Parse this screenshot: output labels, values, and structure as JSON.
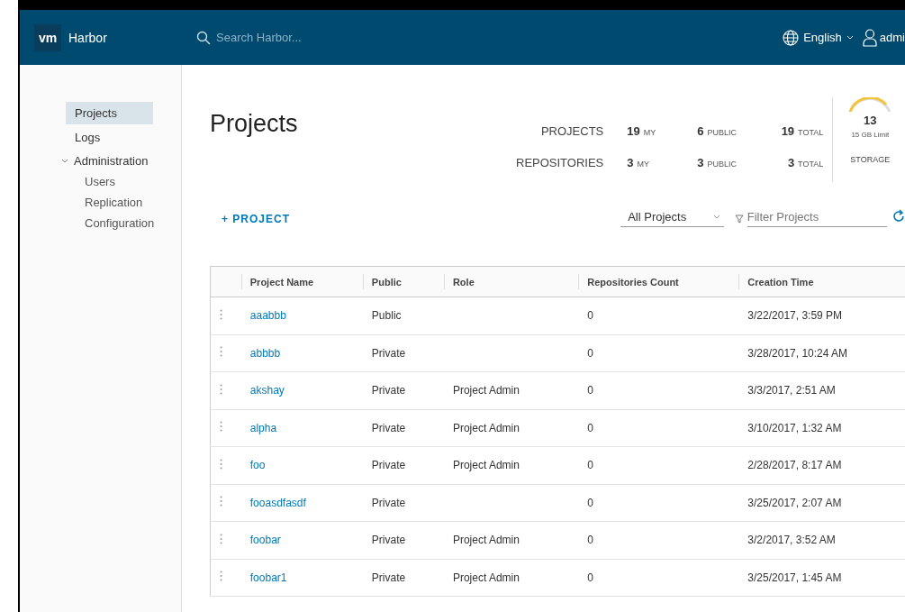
{
  "header": {
    "logo": "vm",
    "product": "Harbor",
    "search": {
      "placeholder": "Search Harbor..."
    },
    "language": "English",
    "user": "admi"
  },
  "sidebar": {
    "items": [
      {
        "label": "Projects",
        "selected": true
      },
      {
        "label": "Logs",
        "selected": false
      },
      {
        "label": "Administration",
        "selected": false,
        "expanded": true,
        "children": [
          {
            "label": "Users",
            "selected": false
          },
          {
            "label": "Replication",
            "selected": false
          },
          {
            "label": "Configuration",
            "selected": false
          }
        ]
      }
    ]
  },
  "page_title": "Projects",
  "stats": {
    "rows": [
      {
        "label": "PROJECTS",
        "cells": [
          {
            "value": "19",
            "unit": "MY"
          },
          {
            "value": "6",
            "unit": "PUBLIC"
          },
          {
            "value": "19",
            "unit": "TOTAL"
          }
        ]
      },
      {
        "label": "REPOSITORIES",
        "cells": [
          {
            "value": "3",
            "unit": "MY"
          },
          {
            "value": "3",
            "unit": "PUBLIC"
          },
          {
            "value": "3",
            "unit": "TOTAL"
          }
        ]
      }
    ],
    "storage": {
      "value": "13",
      "limit": "15 GB Limit",
      "label": "STORAGE"
    }
  },
  "toolbar": {
    "new_button": "+ PROJECT",
    "dropdown": "All Projects",
    "filter": {
      "placeholder": "Filter Projects"
    }
  },
  "table": {
    "columns": [
      "Project Name",
      "Public",
      "Role",
      "Repositories Count",
      "Creation Time"
    ],
    "rows": [
      {
        "name": "aaabbb",
        "public": "Public",
        "role": "",
        "count": "0",
        "created": "3/22/2017, 3:59 PM"
      },
      {
        "name": "abbbb",
        "public": "Private",
        "role": "",
        "count": "0",
        "created": "3/28/2017, 10:24 AM"
      },
      {
        "name": "akshay",
        "public": "Private",
        "role": "Project Admin",
        "count": "0",
        "created": "3/3/2017, 2:51 AM"
      },
      {
        "name": "alpha",
        "public": "Private",
        "role": "Project Admin",
        "count": "0",
        "created": "3/10/2017, 1:32 AM"
      },
      {
        "name": "foo",
        "public": "Private",
        "role": "Project Admin",
        "count": "0",
        "created": "2/28/2017, 8:17 AM"
      },
      {
        "name": "fooasdfasdf",
        "public": "Private",
        "role": "",
        "count": "0",
        "created": "3/25/2017, 2:07 AM"
      },
      {
        "name": "foobar",
        "public": "Private",
        "role": "Project Admin",
        "count": "0",
        "created": "3/2/2017, 3:52 AM"
      },
      {
        "name": "foobar1",
        "public": "Private",
        "role": "Project Admin",
        "count": "0",
        "created": "3/25/2017, 1:45 AM"
      }
    ]
  }
}
